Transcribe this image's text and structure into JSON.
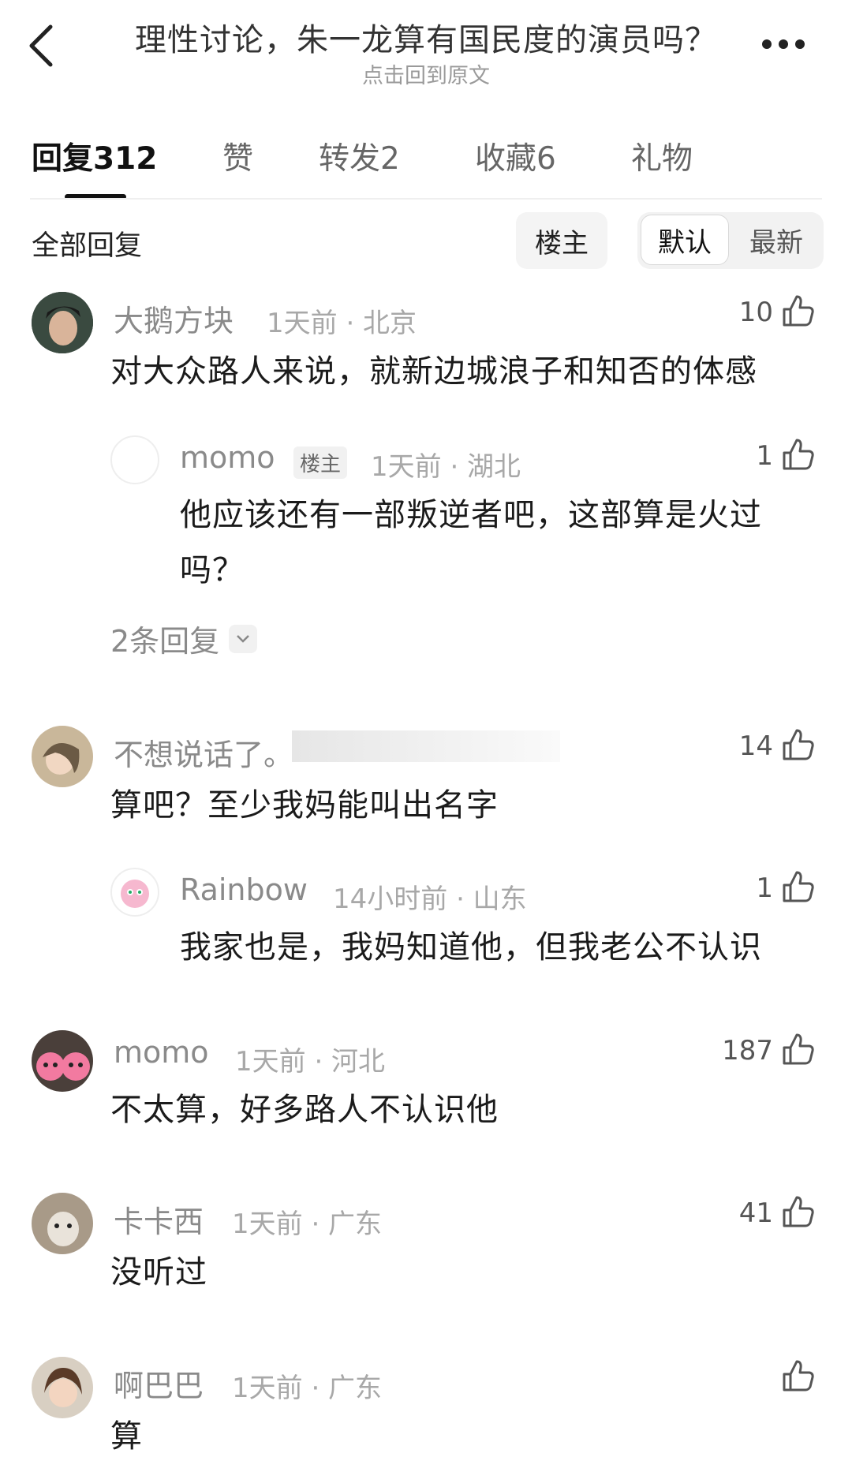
{
  "header": {
    "title": "理性讨论，朱一龙算有国民度的演员吗？",
    "subtitle": "点击回到原文"
  },
  "tabs": [
    {
      "label": "回复312",
      "active": true
    },
    {
      "label": "赞",
      "active": false
    },
    {
      "label": "转发2",
      "active": false
    },
    {
      "label": "收藏6",
      "active": false
    },
    {
      "label": "礼物",
      "active": false
    }
  ],
  "filter": {
    "all_label": "全部回复",
    "op_only": "楼主",
    "sort_default": "默认",
    "sort_latest": "最新"
  },
  "comments": [
    {
      "user": "大鹅方块",
      "meta": "1天前 · 北京",
      "likes": "10",
      "text": "对大众路人来说，就新边城浪子和知否的体感",
      "reply": {
        "user": "momo",
        "badge": "楼主",
        "meta": "1天前 · 湖北",
        "likes": "1",
        "text_line1": "他应该还有一部叛逆者吧，这部算是火过",
        "text_line2": "吗？"
      },
      "more_replies": "2条回复"
    },
    {
      "user": "不想说话了。",
      "meta": "",
      "likes": "14",
      "text": "算吧？至少我妈能叫出名字",
      "reply": {
        "user": "Rainbow",
        "meta": "14小时前 · 山东",
        "likes": "1",
        "text": "我家也是，我妈知道他，但我老公不认识"
      }
    },
    {
      "user": "momo",
      "meta": "1天前 · 河北",
      "likes": "187",
      "text": "不太算，好多路人不认识他"
    },
    {
      "user": "卡卡西",
      "meta": "1天前 · 广东",
      "likes": "41",
      "text": "没听过"
    },
    {
      "user": "啊巴巴",
      "meta": "1天前 · 广东",
      "likes": "",
      "text": "算"
    }
  ],
  "icons": {
    "back": "chevron-left-icon",
    "more": "more-dots-icon",
    "like": "thumbs-up-icon",
    "expand": "chevron-down-icon"
  }
}
